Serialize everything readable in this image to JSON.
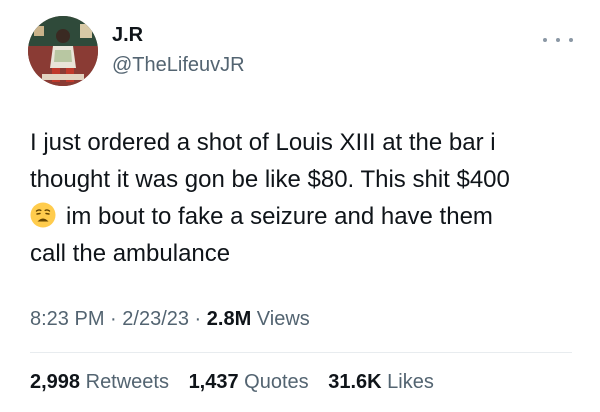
{
  "author": {
    "display_name": "J.R",
    "handle": "@TheLifeuvJR",
    "avatar_icon": "profile-photo"
  },
  "tweet": {
    "lines": [
      "I just ordered a shot of Louis XIII at the bar i",
      "thought it was gon be like $80. This shit $400",
      "im bout to fake a seizure and have them",
      "call the ambulance"
    ],
    "emoji_icon": "weary-face-emoji"
  },
  "meta": {
    "time": "8:23 PM",
    "sep1": " · ",
    "date": "2/23/23",
    "sep2": " · ",
    "views_count": "2.8M",
    "views_label": " Views"
  },
  "stats": {
    "retweets_count": "2,998",
    "retweets_label": " Retweets",
    "quotes_count": "1,437",
    "quotes_label": " Quotes",
    "likes_count": "31.6K",
    "likes_label": " Likes"
  },
  "colors": {
    "text_primary": "#0f1419",
    "text_secondary": "#536471",
    "divider": "#e8ecef"
  }
}
